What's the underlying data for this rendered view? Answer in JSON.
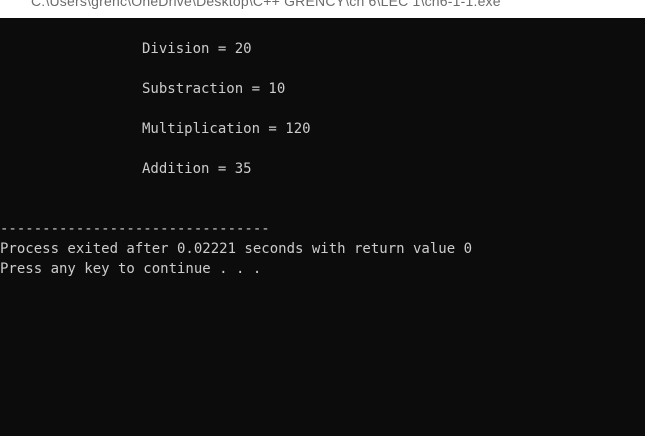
{
  "window": {
    "title": "C:\\Users\\grenc\\OneDrive\\Desktop\\C++ GRENCY\\ch 6\\LEC 1\\ch6-1-1.exe"
  },
  "console": {
    "results": [
      "Division = 20",
      "Substraction = 10",
      "Multiplication = 120",
      "Addition = 35"
    ],
    "separator": "--------------------------------",
    "exit_message": "Process exited after 0.02221 seconds with return value 0",
    "continue_prompt": "Press any key to continue . . ."
  },
  "colors": {
    "console_bg": "#0c0c0c",
    "console_text": "#cccccc",
    "titlebar_bg": "#ffffff"
  }
}
